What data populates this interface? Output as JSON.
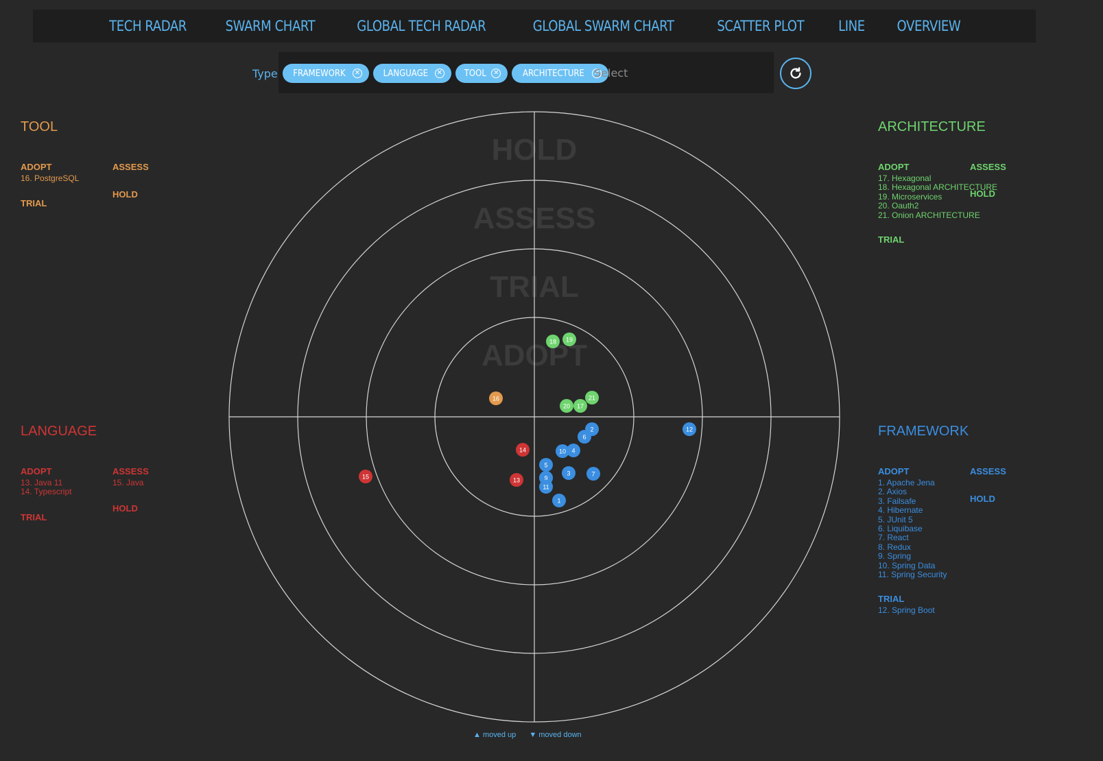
{
  "nav": {
    "items": [
      "TECH RADAR",
      "SWARM CHART",
      "GLOBAL TECH RADAR",
      "GLOBAL SWARM CHART",
      "SCATTER PLOT",
      "LINE",
      "OVERVIEW"
    ]
  },
  "filter": {
    "label": "Type:",
    "chips": [
      "FRAMEWORK",
      "LANGUAGE",
      "TOOL",
      "ARCHITECTURE"
    ],
    "placeholder": "Select"
  },
  "colors": {
    "tool": "#e39a4e",
    "architecture": "#6fd46f",
    "language": "#cf3535",
    "framework": "#3b8ee0",
    "accent": "#5ab3ee",
    "background": "#282828"
  },
  "quadrants": {
    "tool": {
      "title": "TOOL",
      "adopt_label": "ADOPT",
      "adopt_items": [
        "16. PostgreSQL"
      ],
      "trial_label": "TRIAL",
      "assess_label": "ASSESS",
      "hold_label": "HOLD"
    },
    "architecture": {
      "title": "ARCHITECTURE",
      "adopt_label": "ADOPT",
      "adopt_items": [
        "17. Hexagonal",
        "18. Hexagonal ARCHITECTURE",
        "19. Microservices",
        "20. Oauth2",
        "21. Onion ARCHITECTURE"
      ],
      "trial_label": "TRIAL",
      "assess_label": "ASSESS",
      "hold_label": "HOLD"
    },
    "language": {
      "title": "LANGUAGE",
      "adopt_label": "ADOPT",
      "adopt_items": [
        "13. Java 11",
        "14. Typescript"
      ],
      "trial_label": "TRIAL",
      "assess_label": "ASSESS",
      "assess_items": [
        "15. Java"
      ],
      "hold_label": "HOLD"
    },
    "framework": {
      "title": "FRAMEWORK",
      "adopt_label": "ADOPT",
      "adopt_items": [
        "1. Apache Jena",
        "2. Axios",
        "3. Failsafe",
        "4. Hibernate",
        "5. JUnit 5",
        "6. Liquibase",
        "7. React",
        "8. Redux",
        "9. Spring",
        "10. Spring Data",
        "11. Spring Security"
      ],
      "trial_label": "TRIAL",
      "trial_items": [
        "12. Spring Boot"
      ],
      "assess_label": "ASSESS",
      "hold_label": "HOLD"
    }
  },
  "legend": {
    "moved_up": "▲ moved up",
    "moved_down": "▼ moved down"
  },
  "chart_data": {
    "type": "scatter",
    "rings": [
      "ADOPT",
      "TRIAL",
      "ASSESS",
      "HOLD"
    ],
    "quadrants": [
      "ARCHITECTURE",
      "TOOL",
      "LANGUAGE",
      "FRAMEWORK"
    ],
    "blips": [
      {
        "id": 1,
        "label": "1",
        "quadrant": "FRAMEWORK",
        "ring": "ADOPT"
      },
      {
        "id": 2,
        "label": "2",
        "quadrant": "FRAMEWORK",
        "ring": "ADOPT"
      },
      {
        "id": 3,
        "label": "3",
        "quadrant": "FRAMEWORK",
        "ring": "ADOPT"
      },
      {
        "id": 4,
        "label": "4",
        "quadrant": "FRAMEWORK",
        "ring": "ADOPT"
      },
      {
        "id": 5,
        "label": "5",
        "quadrant": "FRAMEWORK",
        "ring": "ADOPT"
      },
      {
        "id": 6,
        "label": "6",
        "quadrant": "FRAMEWORK",
        "ring": "ADOPT"
      },
      {
        "id": 7,
        "label": "7",
        "quadrant": "FRAMEWORK",
        "ring": "ADOPT"
      },
      {
        "id": 8,
        "label": "8",
        "quadrant": "FRAMEWORK",
        "ring": "ADOPT"
      },
      {
        "id": 9,
        "label": "9",
        "quadrant": "FRAMEWORK",
        "ring": "ADOPT"
      },
      {
        "id": 10,
        "label": "10",
        "quadrant": "FRAMEWORK",
        "ring": "ADOPT"
      },
      {
        "id": 11,
        "label": "11",
        "quadrant": "FRAMEWORK",
        "ring": "ADOPT"
      },
      {
        "id": 12,
        "label": "12",
        "quadrant": "FRAMEWORK",
        "ring": "TRIAL"
      },
      {
        "id": 13,
        "label": "13",
        "quadrant": "LANGUAGE",
        "ring": "ADOPT"
      },
      {
        "id": 14,
        "label": "14",
        "quadrant": "LANGUAGE",
        "ring": "ADOPT"
      },
      {
        "id": 15,
        "label": "15",
        "quadrant": "LANGUAGE",
        "ring": "ASSESS"
      },
      {
        "id": 16,
        "label": "16",
        "quadrant": "TOOL",
        "ring": "ADOPT"
      },
      {
        "id": 17,
        "label": "17",
        "quadrant": "ARCHITECTURE",
        "ring": "ADOPT"
      },
      {
        "id": 18,
        "label": "18",
        "quadrant": "ARCHITECTURE",
        "ring": "ADOPT"
      },
      {
        "id": 19,
        "label": "19",
        "quadrant": "ARCHITECTURE",
        "ring": "ADOPT"
      },
      {
        "id": 20,
        "label": "20",
        "quadrant": "ARCHITECTURE",
        "ring": "ADOPT"
      },
      {
        "id": 21,
        "label": "21",
        "quadrant": "ARCHITECTURE",
        "ring": "ADOPT"
      }
    ]
  }
}
